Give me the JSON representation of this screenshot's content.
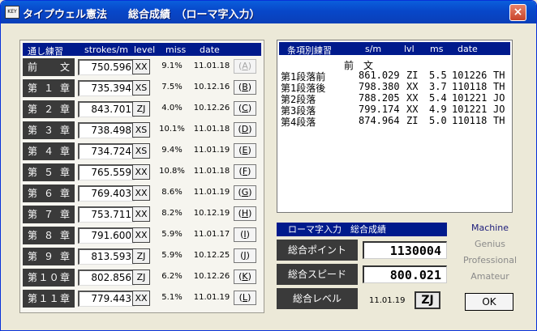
{
  "window": {
    "title": "タイプウェル憲法　　総合成績　（ローマ字入力）",
    "icon_text": "KEY",
    "close_glyph": "×"
  },
  "left_panel": {
    "headers": {
      "title": "通し練習",
      "strokes": "strokes/m",
      "level": "level",
      "miss": "miss",
      "date": "date"
    },
    "rows": [
      {
        "chapter": "前文",
        "strokes": "750.596",
        "level": "XX",
        "miss": "9.1%",
        "date": "11.01.18",
        "key": "A",
        "disabled": true
      },
      {
        "chapter": "第１章",
        "strokes": "735.394",
        "level": "XS",
        "miss": "7.5%",
        "date": "10.12.16",
        "key": "B",
        "disabled": false
      },
      {
        "chapter": "第２章",
        "strokes": "843.701",
        "level": "ZJ",
        "miss": "4.0%",
        "date": "10.12.26",
        "key": "C",
        "disabled": false
      },
      {
        "chapter": "第３章",
        "strokes": "738.498",
        "level": "XS",
        "miss": "10.1%",
        "date": "11.01.18",
        "key": "D",
        "disabled": false
      },
      {
        "chapter": "第４章",
        "strokes": "734.724",
        "level": "XS",
        "miss": "9.4%",
        "date": "11.01.19",
        "key": "E",
        "disabled": false
      },
      {
        "chapter": "第５章",
        "strokes": "765.559",
        "level": "XX",
        "miss": "10.8%",
        "date": "11.01.18",
        "key": "F",
        "disabled": false
      },
      {
        "chapter": "第６章",
        "strokes": "769.403",
        "level": "XX",
        "miss": "8.6%",
        "date": "11.01.19",
        "key": "G",
        "disabled": false
      },
      {
        "chapter": "第７章",
        "strokes": "753.711",
        "level": "XX",
        "miss": "8.2%",
        "date": "10.12.19",
        "key": "H",
        "disabled": false
      },
      {
        "chapter": "第８章",
        "strokes": "791.600",
        "level": "XX",
        "miss": "5.9%",
        "date": "11.01.17",
        "key": "I",
        "disabled": false
      },
      {
        "chapter": "第９章",
        "strokes": "813.593",
        "level": "ZJ",
        "miss": "5.9%",
        "date": "10.12.25",
        "key": "J",
        "disabled": false
      },
      {
        "chapter": "第１０章",
        "strokes": "802.856",
        "level": "ZJ",
        "miss": "6.2%",
        "date": "10.12.26",
        "key": "K",
        "disabled": false
      },
      {
        "chapter": "第１１章",
        "strokes": "779.443",
        "level": "XX",
        "miss": "5.1%",
        "date": "11.01.19",
        "key": "L",
        "disabled": false
      }
    ]
  },
  "detail_panel": {
    "headers": {
      "title": "条項別練習",
      "sm": "s/m",
      "lvl": "lvl",
      "ms": "ms",
      "date": "date"
    },
    "section_title": "前　文",
    "rows": [
      {
        "name": "第1段落前",
        "sm": "861.029",
        "lvl": "ZI",
        "ms": "5.5",
        "date": "101226",
        "user": "TH"
      },
      {
        "name": "第1段落後",
        "sm": "798.380",
        "lvl": "XX",
        "ms": "3.7",
        "date": "110118",
        "user": "TH"
      },
      {
        "name": "第2段落",
        "sm": "788.205",
        "lvl": "XX",
        "ms": "5.4",
        "date": "101221",
        "user": "JO"
      },
      {
        "name": "第3段落",
        "sm": "799.174",
        "lvl": "XX",
        "ms": "4.9",
        "date": "101221",
        "user": "JO"
      },
      {
        "name": "第4段落",
        "sm": "874.964",
        "lvl": "ZI",
        "ms": "5.0",
        "date": "110118",
        "user": "TH"
      }
    ]
  },
  "summary": {
    "header": "ローマ字入力　総合成績",
    "points_label": "総合ポイント",
    "points_value": "1130004",
    "speed_label": "総合スピード",
    "speed_value": "800.021",
    "level_label": "総合レベル",
    "level_date": "11.01.19",
    "level_value": "ZJ"
  },
  "ranks": {
    "items": [
      "Machine",
      "Genius",
      "Professional",
      "Amateur"
    ],
    "active_color": "#1b1b7a",
    "inactive_color": "#8a8a8a"
  },
  "buttons": {
    "ok": "OK"
  }
}
